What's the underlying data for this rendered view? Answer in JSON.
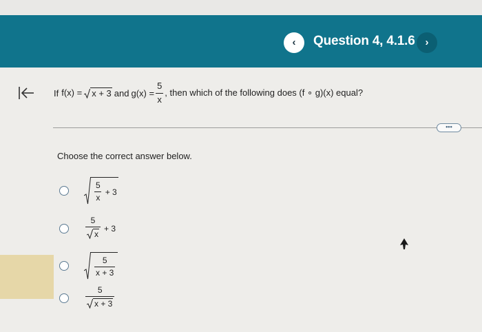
{
  "header": {
    "title": "Question 4, 4.1.6",
    "prev_icon": "‹",
    "next_icon": "›",
    "color": "#10748c"
  },
  "question": {
    "intro": "If",
    "f_lhs": "f(x) =",
    "f_radicand": "x + 3",
    "and_text": "and",
    "g_lhs": "g(x) =",
    "g_num": "5",
    "g_den": "x",
    "tail": ", then which of the following does (f ∘ g)(x) equal?"
  },
  "more_label": "•••",
  "instruction": "Choose the correct answer below.",
  "options": [
    {
      "num": "5",
      "den": "x",
      "plus": "+ 3"
    },
    {
      "num": "5",
      "den_radicand": "x",
      "plus": "+ 3"
    },
    {
      "num": "5",
      "den": "x + 3"
    },
    {
      "num": "5",
      "den_radicand": "x + 3"
    }
  ],
  "icons": [
    "back-to-start-icon",
    "chevron-left-icon",
    "chevron-right-icon",
    "more-options-icon",
    "mouse-pointer-icon"
  ]
}
